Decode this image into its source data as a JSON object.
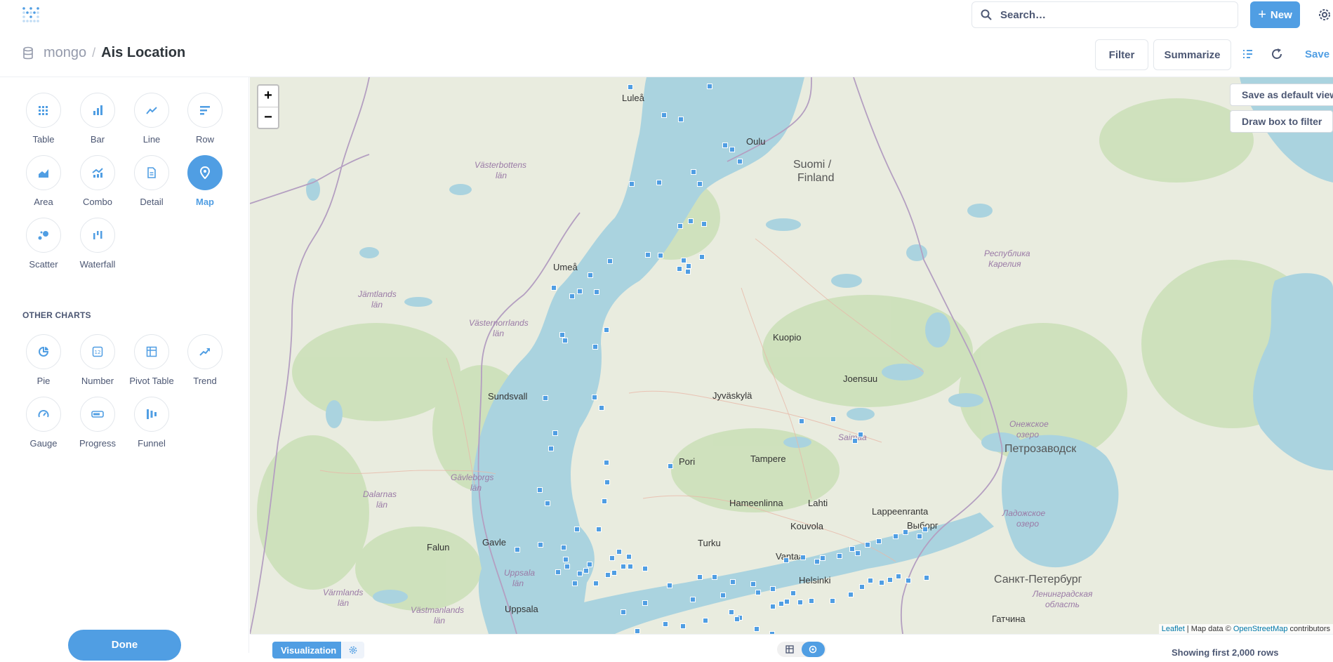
{
  "nav": {
    "search_placeholder": "Search…",
    "new_label": "New"
  },
  "header": {
    "database": "mongo",
    "separator": "/",
    "title": "Ais Location",
    "filter_label": "Filter",
    "summarize_label": "Summarize",
    "save_label": "Save"
  },
  "sidebar": {
    "charts": [
      {
        "label": "Table",
        "icon": "table-icon"
      },
      {
        "label": "Bar",
        "icon": "bar-chart-icon"
      },
      {
        "label": "Line",
        "icon": "line-chart-icon"
      },
      {
        "label": "Row",
        "icon": "row-chart-icon"
      },
      {
        "label": "Area",
        "icon": "area-chart-icon"
      },
      {
        "label": "Combo",
        "icon": "combo-chart-icon"
      },
      {
        "label": "Detail",
        "icon": "document-icon"
      },
      {
        "label": "Map",
        "icon": "pin-icon",
        "active": true
      },
      {
        "label": "Scatter",
        "icon": "scatter-icon"
      },
      {
        "label": "Waterfall",
        "icon": "waterfall-icon"
      }
    ],
    "other_title": "OTHER CHARTS",
    "other_charts": [
      {
        "label": "Pie",
        "icon": "pie-icon"
      },
      {
        "label": "Number",
        "icon": "number-icon"
      },
      {
        "label": "Pivot Table",
        "icon": "pivot-table-icon"
      },
      {
        "label": "Trend",
        "icon": "trend-icon"
      },
      {
        "label": "Gauge",
        "icon": "gauge-icon"
      },
      {
        "label": "Progress",
        "icon": "progress-icon"
      },
      {
        "label": "Funnel",
        "icon": "funnel-icon"
      }
    ],
    "done_label": "Done"
  },
  "map": {
    "zoom_in": "+",
    "zoom_out": "−",
    "save_default_view": "Save as default view",
    "draw_box": "Draw box to filter",
    "attribution_leaflet": "Leaflet",
    "attribution_text": " | Map data © ",
    "attribution_osm": "OpenStreetMap",
    "attribution_tail": " contributors",
    "places": {
      "lulea": "Luleå",
      "oulu": "Oulu",
      "finland_1": "Suomi /",
      "finland_2": "Finland",
      "vasterbotten_1": "Västerbottens",
      "vasterbotten_2": "län",
      "umea": "Umeå",
      "jamtland_1": "Jämtlands",
      "jamtland_2": "län",
      "vasternorrland_1": "Västernorrlands",
      "vasternorrland_2": "län",
      "karelia_1": "Республика",
      "karelia_2": "Карелия",
      "kuopio": "Kuopio",
      "joensuu": "Joensuu",
      "jyvaskyla": "Jyväskylä",
      "sundsvall": "Sundsvall",
      "onega_1": "Онежское",
      "onega_2": "озеро",
      "saimaa": "Saimaa",
      "petrozavodsk": "Петрозаводск",
      "pori": "Pori",
      "tampere": "Tampere",
      "gavleborg_1": "Gävleborgs",
      "gavleborg_2": "län",
      "dalarna_1": "Dalarnas",
      "dalarna_2": "län",
      "hameenlinna": "Hameenlinna",
      "lahti": "Lahti",
      "lappeenranta": "Lappeenranta",
      "ladoga_1": "Ладожское",
      "ladoga_2": "озеро",
      "kouvola": "Kouvola",
      "vyborg": "Выборг",
      "falun": "Falun",
      "gavle": "Gavle",
      "turku": "Turku",
      "vantaa": "Vantaa",
      "uppsala_region_1": "Uppsala",
      "uppsala_region_2": "län",
      "helsinki": "Helsinki",
      "spb": "Санкт-Петербург",
      "leningrad_1": "Ленинградская",
      "leningrad_2": "область",
      "varmland_1": "Värmlands",
      "varmland_2": "län",
      "vastmanland_1": "Västmanlands",
      "vastmanland_2": "län",
      "uppsala": "Uppsala",
      "gatchina": "Гатчина"
    }
  },
  "footer": {
    "visualization_label": "Visualization",
    "rows_text": "Showing first 2,000 rows"
  },
  "colors": {
    "brand": "#509ee3",
    "water": "#aad3df",
    "land": "#e9ecdf",
    "forest": "#c8dfb4"
  }
}
